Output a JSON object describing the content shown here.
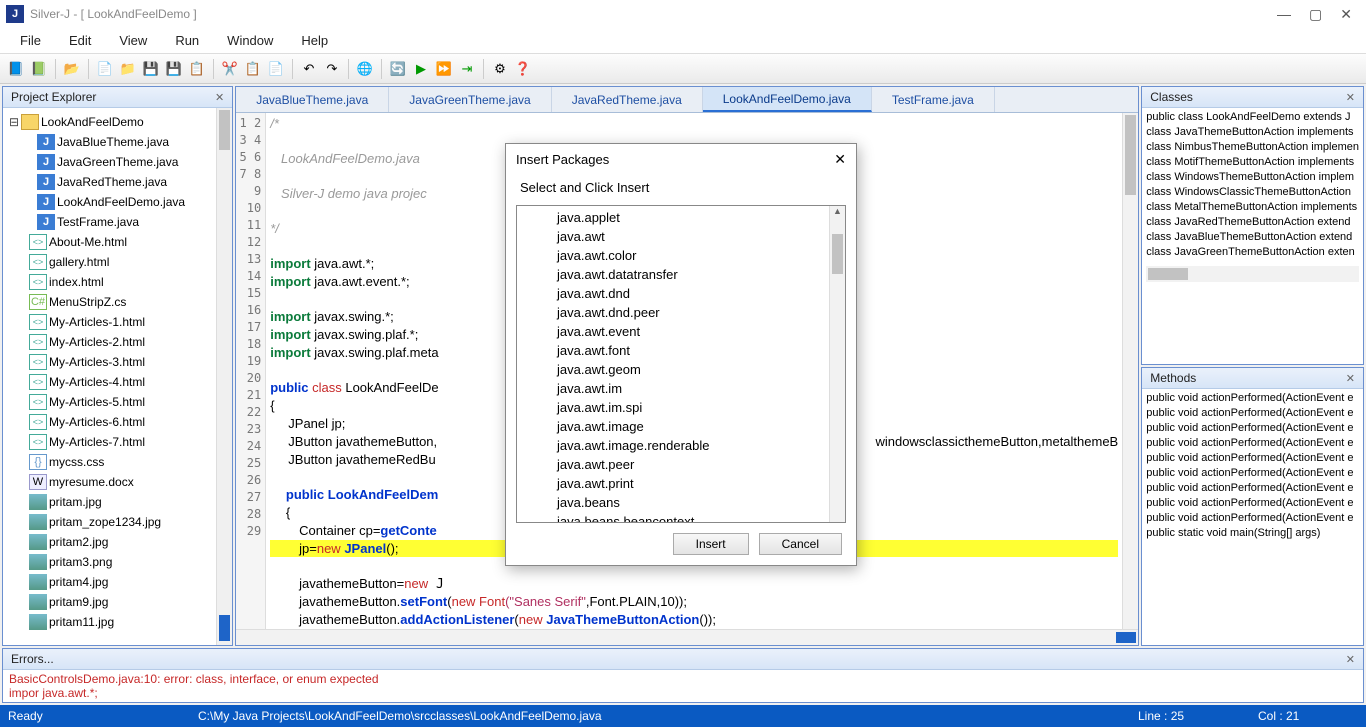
{
  "window": {
    "app_icon_letter": "J",
    "title": "Silver-J - [ LookAndFeelDemo ]",
    "minimize": "—",
    "maximize": "▢",
    "close": "✕"
  },
  "menu": [
    "File",
    "Edit",
    "View",
    "Run",
    "Window",
    "Help"
  ],
  "explorer": {
    "title": "Project Explorer",
    "root": "LookAndFeelDemo",
    "java_files": [
      "JavaBlueTheme.java",
      "JavaGreenTheme.java",
      "JavaRedTheme.java",
      "LookAndFeelDemo.java",
      "TestFrame.java"
    ],
    "other_files": [
      {
        "n": "About-Me.html",
        "t": "html"
      },
      {
        "n": "gallery.html",
        "t": "html"
      },
      {
        "n": "index.html",
        "t": "html"
      },
      {
        "n": "MenuStripZ.cs",
        "t": "cs"
      },
      {
        "n": "My-Articles-1.html",
        "t": "html"
      },
      {
        "n": "My-Articles-2.html",
        "t": "html"
      },
      {
        "n": "My-Articles-3.html",
        "t": "html"
      },
      {
        "n": "My-Articles-4.html",
        "t": "html"
      },
      {
        "n": "My-Articles-5.html",
        "t": "html"
      },
      {
        "n": "My-Articles-6.html",
        "t": "html"
      },
      {
        "n": "My-Articles-7.html",
        "t": "html"
      },
      {
        "n": "mycss.css",
        "t": "css"
      },
      {
        "n": "myresume.docx",
        "t": "docx"
      },
      {
        "n": "pritam.jpg",
        "t": "img"
      },
      {
        "n": "pritam_zope1234.jpg",
        "t": "img"
      },
      {
        "n": "pritam2.jpg",
        "t": "img"
      },
      {
        "n": "pritam3.png",
        "t": "img"
      },
      {
        "n": "pritam4.jpg",
        "t": "img"
      },
      {
        "n": "pritam9.jpg",
        "t": "img"
      },
      {
        "n": "pritam11.jpg",
        "t": "img"
      }
    ]
  },
  "tabs": [
    "JavaBlueTheme.java",
    "JavaGreenTheme.java",
    "JavaRedTheme.java",
    "LookAndFeelDemo.java",
    "TestFrame.java"
  ],
  "active_tab": 3,
  "code": {
    "line_start": 1,
    "line_end": 29,
    "comment1": "/*",
    "comment2": "   LookAndFeelDemo.java",
    "comment3": "   Silver-J demo java projec",
    "comment4": "*/",
    "imp": "import",
    "i1": " java.awt.*;",
    "i2": " java.awt.event.*;",
    "i3": " javax.swing.*;",
    "i4": " javax.swing.plaf.*;",
    "i5": " javax.swing.plaf.meta",
    "pub": "public",
    "cls": " class",
    "clsname": " LookAndFeelDe",
    "brace": "{",
    "jp": "     JPanel jp;",
    "jb1": "     JButton javathemeButton,",
    "jb1b": "windowsclassicthemeButton,metalthemeB",
    "jb2": "     JButton javathemeRedBu",
    "ctor": " LookAndFeelDem",
    "cont": "        Container cp=",
    "getc": "getConte",
    "hl_pre": "jp",
    "hl_eq": "=",
    "hl_new": "new",
    "hl_jp": " JPanel",
    "hl_paren": "();",
    "l27a": "        javathemeButton=",
    "l27b": "new",
    "l28a": "        javathemeButton.",
    "l28b": "setFont",
    "l28c": "(",
    "l28d": "new Font",
    "l28e": "(\"Sanes Serif\"",
    "l28f": ",Font.PLAIN,10));",
    "l29a": "        javathemeButton.",
    "l29b": "addActionListener",
    "l29c": "(",
    "l29d": "new",
    "l29e": " JavaThemeButtonAction",
    "l29f": "());"
  },
  "classes_panel": {
    "title": "Classes",
    "items": [
      "public class LookAndFeelDemo extends J",
      "class JavaThemeButtonAction implements",
      "class NimbusThemeButtonAction implemen",
      "class MotifThemeButtonAction implements",
      "class WindowsThemeButtonAction implem",
      "class WindowsClassicThemeButtonAction",
      "class MetalThemeButtonAction implements",
      "class JavaRedThemeButtonAction extend",
      "class JavaBlueThemeButtonAction extend",
      "class JavaGreenThemeButtonAction exten"
    ]
  },
  "methods_panel": {
    "title": "Methods",
    "items": [
      "public void actionPerformed(ActionEvent e",
      "public void actionPerformed(ActionEvent e",
      "public void actionPerformed(ActionEvent e",
      "public void actionPerformed(ActionEvent e",
      "public void actionPerformed(ActionEvent e",
      "public void actionPerformed(ActionEvent e",
      "public void actionPerformed(ActionEvent e",
      "public void actionPerformed(ActionEvent e",
      "public void actionPerformed(ActionEvent e",
      "public static void main(String[] args)"
    ]
  },
  "errors": {
    "title": "Errors...",
    "line1": "BasicControlsDemo.java:10: error: class, interface, or enum expected",
    "line2": "impor java.awt.*;"
  },
  "status": {
    "ready": "Ready",
    "path": "C:\\My Java Projects\\LookAndFeelDemo\\srcclasses\\LookAndFeelDemo.java",
    "line": "Line : 25",
    "col": "Col : 21"
  },
  "modal": {
    "title": "Insert Packages",
    "close": "✕",
    "sub": "Select and Click Insert",
    "items": [
      "java.applet",
      "java.awt",
      "java.awt.color",
      "java.awt.datatransfer",
      "java.awt.dnd",
      "java.awt.dnd.peer",
      "java.awt.event",
      "java.awt.font",
      "java.awt.geom",
      "java.awt.im",
      "java.awt.im.spi",
      "java.awt.image",
      "java.awt.image.renderable",
      "java.awt.peer",
      "java.awt.print",
      "java.beans",
      "java.beans.beancontext"
    ],
    "insert": "Insert",
    "cancel": "Cancel"
  }
}
